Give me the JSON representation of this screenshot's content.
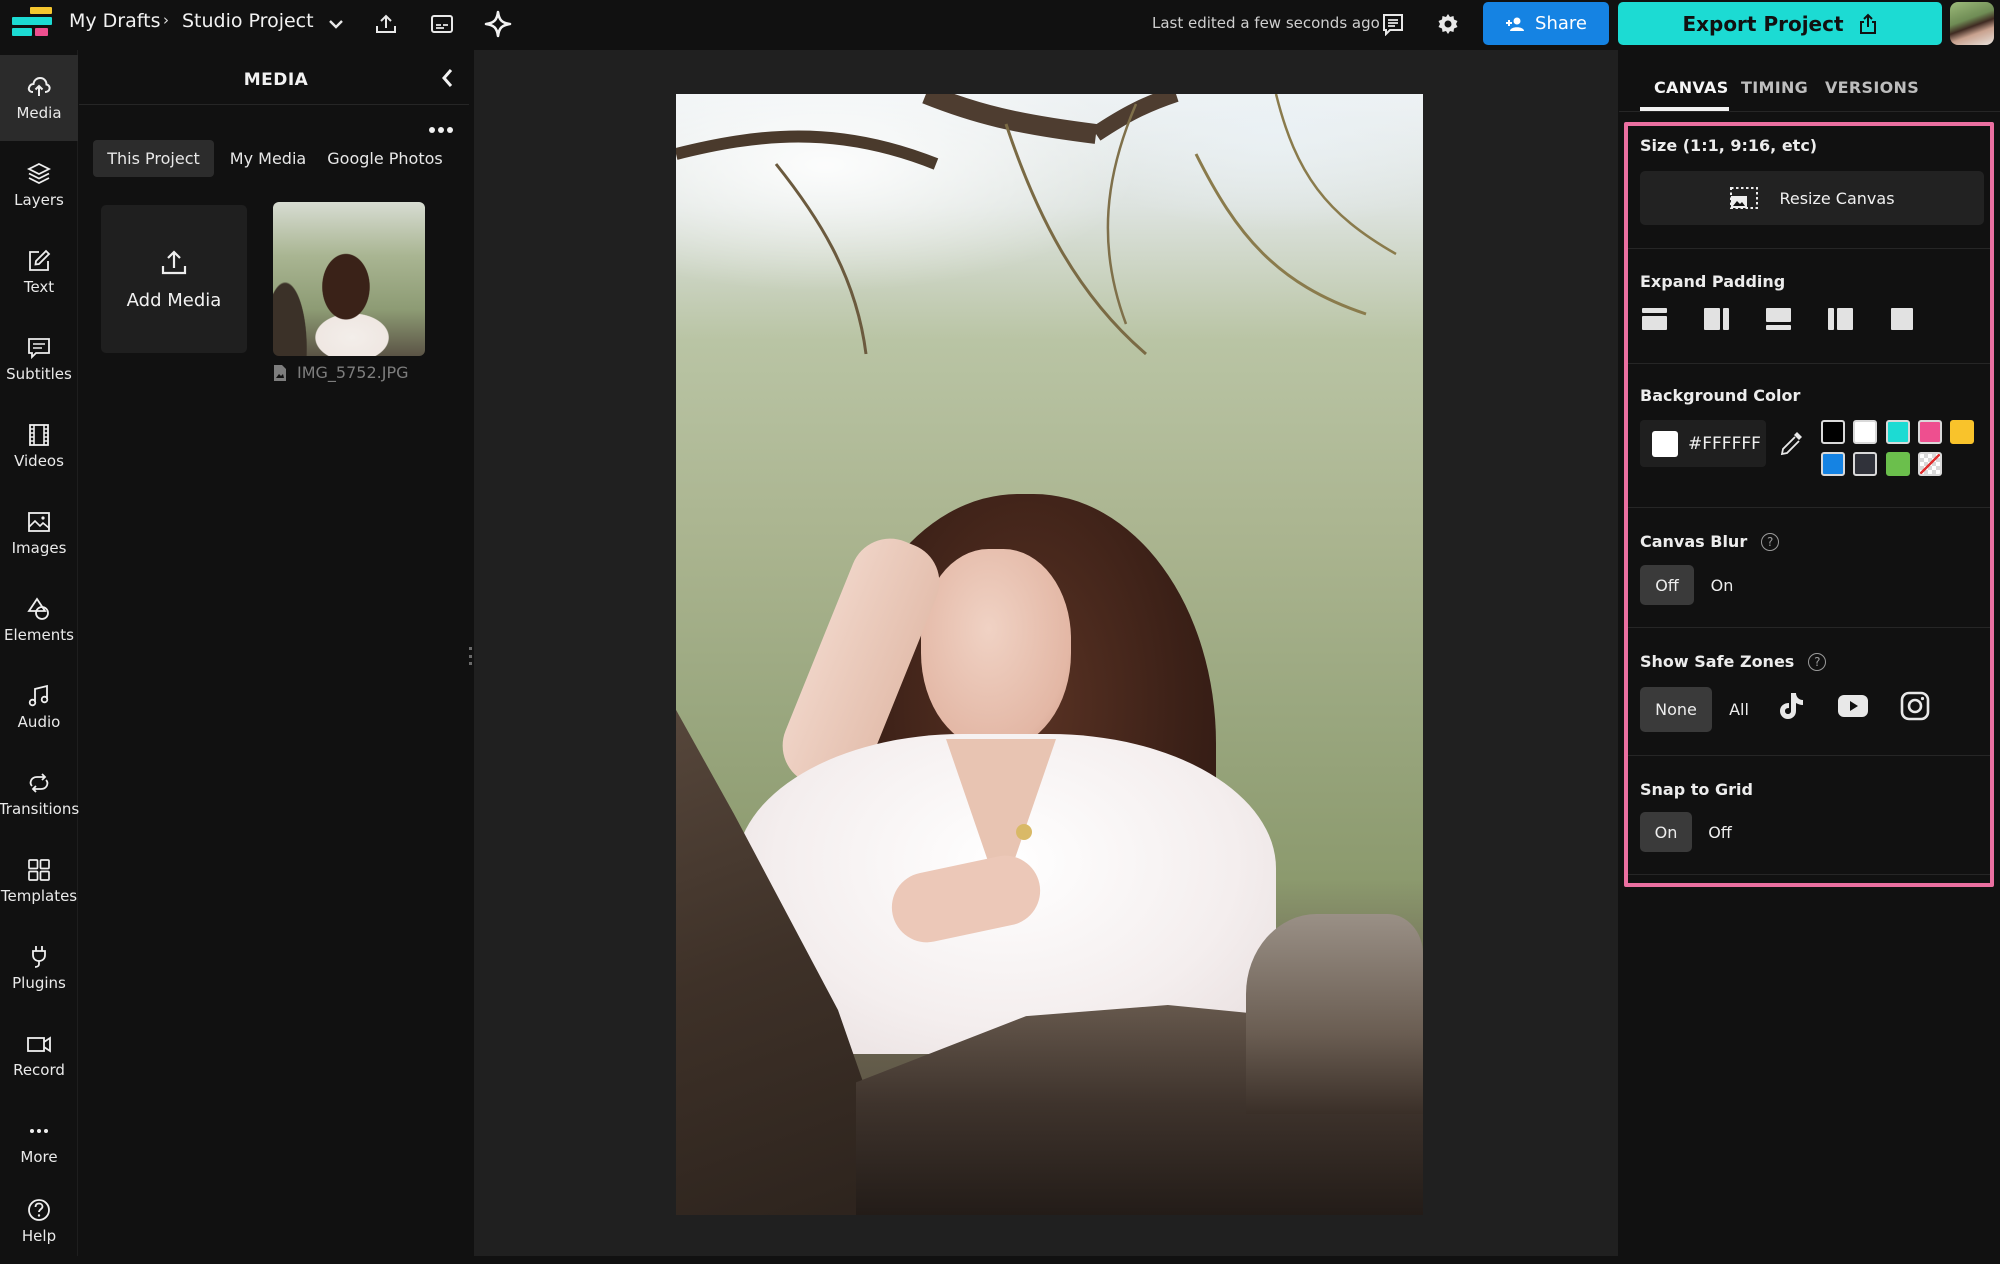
{
  "topbar": {
    "logo_colors": {
      "yellow": "#f5c62f",
      "cyan": "#1cdbd3",
      "pink": "#ee4f8f"
    },
    "breadcrumb_root": "My Drafts",
    "breadcrumb_separator": "›",
    "project_name": "Studio Project",
    "icons": [
      "chevron-down-icon",
      "upload-icon",
      "subtitles-icon",
      "sparkle-icon"
    ],
    "last_edited": "Last edited a few seconds ago",
    "comments_icon": "comment-icon",
    "settings_icon": "gear-icon",
    "share_label": "Share",
    "export_label": "Export Project",
    "share_color": "#1583e3",
    "export_color": "#1cdbd3"
  },
  "rail": {
    "items": [
      {
        "label": "Media",
        "icon": "cloud-upload-icon",
        "active": true
      },
      {
        "label": "Layers",
        "icon": "layers-icon"
      },
      {
        "label": "Text",
        "icon": "edit-text-icon"
      },
      {
        "label": "Subtitles",
        "icon": "subtitles-icon"
      },
      {
        "label": "Videos",
        "icon": "film-icon"
      },
      {
        "label": "Images",
        "icon": "image-icon"
      },
      {
        "label": "Elements",
        "icon": "shapes-icon"
      },
      {
        "label": "Audio",
        "icon": "music-note-icon"
      },
      {
        "label": "Transitions",
        "icon": "transition-icon"
      },
      {
        "label": "Templates",
        "icon": "grid-icon"
      },
      {
        "label": "Plugins",
        "icon": "plug-icon"
      },
      {
        "label": "Record",
        "icon": "camera-icon"
      },
      {
        "label": "More",
        "icon": "ellipsis-icon"
      },
      {
        "label": "Help",
        "icon": "help-icon"
      }
    ]
  },
  "media_panel": {
    "title": "MEDIA",
    "tabs": [
      {
        "label": "This Project",
        "active": true
      },
      {
        "label": "My Media"
      },
      {
        "label": "Google Photos"
      }
    ],
    "add_media_label": "Add Media",
    "files": [
      {
        "name": "IMG_5752.JPG",
        "type": "image"
      }
    ]
  },
  "right_panel": {
    "tabs": [
      {
        "label": "CANVAS",
        "active": true
      },
      {
        "label": "TIMING"
      },
      {
        "label": "VERSIONS"
      }
    ],
    "highlight_color": "#ea6fa0",
    "size": {
      "title": "Size (1:1, 9:16, etc)",
      "button_label": "Resize Canvas"
    },
    "expand_padding": {
      "title": "Expand Padding",
      "options": [
        "pad-top-icon",
        "pad-right-icon",
        "pad-bottom-icon",
        "pad-left-icon",
        "pad-all-icon"
      ]
    },
    "background_color": {
      "title": "Background Color",
      "value": "#FFFFFF",
      "swatches": [
        "#000000",
        "#ffffff",
        "#1cdbd3",
        "#ee4f8f",
        "#f9c32b",
        "#1583e3",
        "#30323a",
        "#6bbf4c",
        "transparent"
      ]
    },
    "canvas_blur": {
      "title": "Canvas Blur",
      "options": [
        "Off",
        "On"
      ],
      "selected": "Off"
    },
    "safe_zones": {
      "title": "Show Safe Zones",
      "options": [
        "None",
        "All"
      ],
      "selected": "None",
      "platforms": [
        "tiktok-icon",
        "youtube-icon",
        "instagram-icon"
      ]
    },
    "snap_to_grid": {
      "title": "Snap to Grid",
      "options": [
        "On",
        "Off"
      ],
      "selected": "On"
    }
  }
}
